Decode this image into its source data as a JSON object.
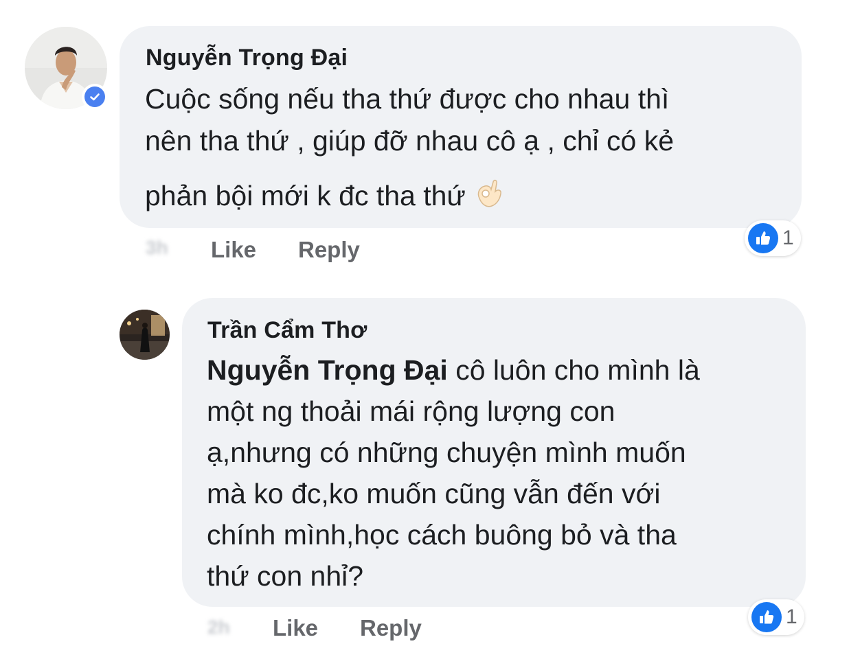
{
  "comments": [
    {
      "author": "Nguyễn Trọng Đại",
      "verified": true,
      "avatar_icon": "profile-photo",
      "lines": [
        "Cuộc sống nếu tha thứ được cho nhau thì",
        "nên tha thứ , giúp đỡ nhau cô ạ ,  chỉ có kẻ",
        "phản bội mới k đc tha thứ"
      ],
      "emoji": "ok-hand-emoji",
      "time": "3h",
      "like_label": "Like",
      "reply_label": "Reply",
      "reaction_icon": "thumbs-up-icon",
      "reaction_count": "1"
    },
    {
      "author": "Trần Cẩm Thơ",
      "verified": false,
      "avatar_icon": "profile-photo",
      "mention": "Nguyễn Trọng Đại",
      "lines": [
        " cô luôn cho mình là",
        "một ng thoải mái rộng lượng con",
        "ạ,nhưng có những chuyện mình muốn",
        "mà ko đc,ko muốn cũng vẫn đến với",
        "chính mình,học cách buông bỏ và tha",
        "thứ con nhỉ?"
      ],
      "time": "2h",
      "like_label": "Like",
      "reply_label": "Reply",
      "reaction_icon": "thumbs-up-icon",
      "reaction_count": "1"
    }
  ],
  "colors": {
    "bubble": "#f0f2f5",
    "meta_text": "#65676b",
    "like_blue": "#1877f2",
    "verified_blue": "#4a80f0"
  }
}
